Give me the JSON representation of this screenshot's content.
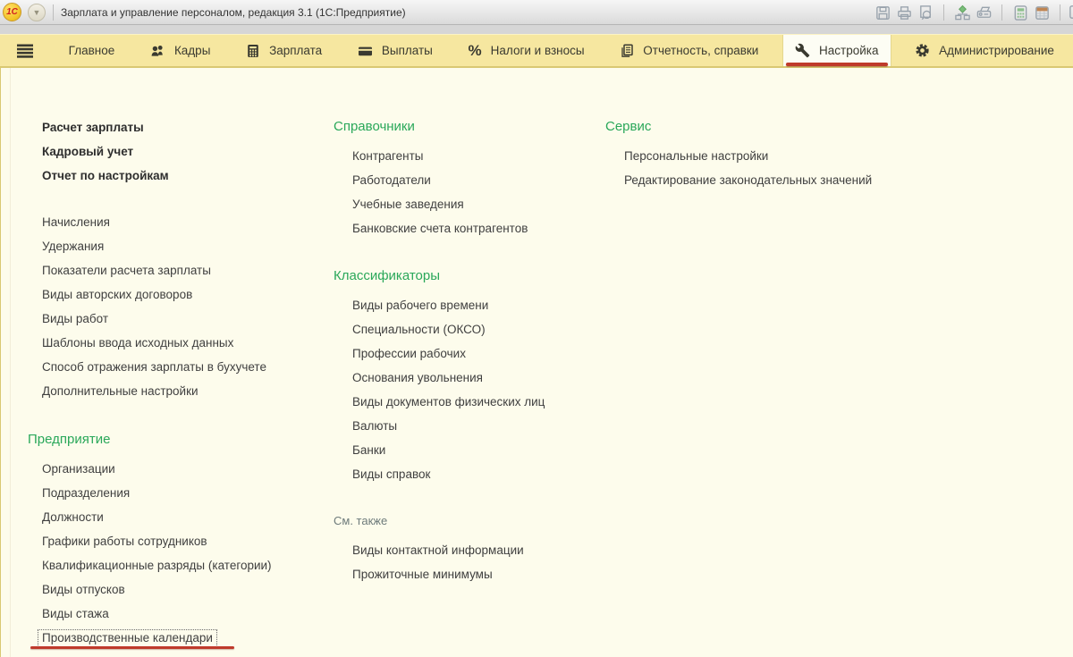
{
  "colors": {
    "accent_green": "#2aa85a",
    "annotation_red": "#bf3a2b",
    "tab_yellow": "#f6e7a0",
    "panel_cream": "#fdfcec"
  },
  "titlebar": {
    "logo": "1С",
    "title": "Зарплата и управление персоналом, редакция 3.1  (1С:Предприятие)",
    "dropdown_glyph": "▼"
  },
  "tabbar": {
    "tabs": [
      {
        "label": "Главное"
      },
      {
        "label": "Кадры"
      },
      {
        "label": "Зарплата"
      },
      {
        "label": "Выплаты"
      },
      {
        "label": "Налоги и взносы"
      },
      {
        "label": "Отчетность, справки"
      },
      {
        "label": "Настройка",
        "active": true
      },
      {
        "label": "Администрирование"
      }
    ],
    "percent_glyph": "%"
  },
  "menu": {
    "column1": {
      "commands": [
        "Расчет зарплаты",
        "Кадровый учет",
        "Отчет по настройкам"
      ],
      "links": [
        "Начисления",
        "Удержания",
        "Показатели расчета зарплаты",
        "Виды авторских договоров",
        "Виды работ",
        "Шаблоны ввода исходных данных",
        "Способ отражения зарплаты в бухучете",
        "Дополнительные настройки"
      ],
      "group": {
        "header": "Предприятие",
        "links": [
          "Организации",
          "Подразделения",
          "Должности",
          "Графики работы сотрудников",
          "Квалификационные разряды (категории)",
          "Виды отпусков",
          "Виды стажа",
          "Производственные календари"
        ]
      }
    },
    "column2": {
      "group1": {
        "header": "Справочники",
        "links": [
          "Контрагенты",
          "Работодатели",
          "Учебные заведения",
          "Банковские счета контрагентов"
        ]
      },
      "group2": {
        "header": "Классификаторы",
        "links": [
          "Виды рабочего времени",
          "Специальности (ОКСО)",
          "Профессии рабочих",
          "Основания увольнения",
          "Виды документов физических лиц",
          "Валюты",
          "Банки",
          "Виды справок"
        ]
      },
      "seealso": {
        "header": "См. также",
        "links": [
          "Виды контактной информации",
          "Прожиточные минимумы"
        ]
      }
    },
    "column3": {
      "group": {
        "header": "Сервис",
        "links": [
          "Персональные настройки",
          "Редактирование законодательных значений"
        ]
      }
    }
  }
}
